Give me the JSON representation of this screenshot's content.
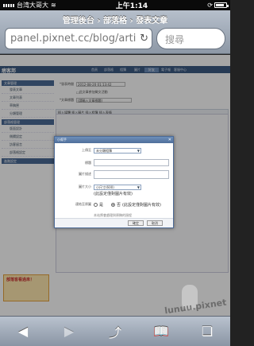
{
  "status_bar": {
    "carrier": "台湾大哥大",
    "time": "上午1:14"
  },
  "browser": {
    "page_title": "管理後台 › 部落格 › 發表文章",
    "url": "panel.pixnet.cc/blog/arti",
    "search_placeholder": "搜尋"
  },
  "site": {
    "logo": "痞客邦",
    "nav": [
      "首頁",
      "部落格",
      "相簿",
      "圖片",
      "好友",
      "電子報",
      "客服中心"
    ],
    "active_nav_index": 4
  },
  "sidebar": {
    "sections": [
      {
        "heading": "文章管理",
        "items": [
          "發表文章",
          "文章列表",
          "草稿匣",
          "分類管理"
        ]
      },
      {
        "heading": "部落格管理",
        "items": [
          "版面設計",
          "側欄設定",
          "訪客留言",
          "部落格設定"
        ]
      },
      {
        "heading": "進階設定",
        "items": []
      }
    ],
    "promo_text": "部落客看過來！"
  },
  "editor": {
    "date_label": "*發表時間",
    "date_value": "2012-08-20 01:13:42",
    "title_label": "*文章標題",
    "title_value": "(請輸入文章標題)",
    "checkbox_label": "此文章參加徵文活動",
    "toolbar_label": "插入媒體  插入圖片  插入相簿  插入表情"
  },
  "modal": {
    "title": "小幫手",
    "fields": [
      {
        "label": "上傳至",
        "type": "select",
        "value": "未分類相簿"
      },
      {
        "label": "標題",
        "type": "input",
        "value": ""
      },
      {
        "label": "圖片描述",
        "type": "input",
        "value": ""
      },
      {
        "label": "圖片大小",
        "type": "select",
        "value": "小尺寸(600)"
      }
    ],
    "size_note": "(此設定僅對圖片有效)",
    "link_label": "連結至原圖",
    "radio_yes": "是",
    "radio_no": "否",
    "radio_note": "(此設定僅對圖片有效)",
    "radio_selected": "否",
    "footnote": "本站將會處理與原稿的過程",
    "btn_ok": "確定",
    "btn_cancel": "取消"
  },
  "watermark": "lunuu.pixnet",
  "toolbar": {
    "back": "◀",
    "forward": "▶",
    "share": "⤴",
    "bookmarks": "📖",
    "tabs": "❏"
  }
}
